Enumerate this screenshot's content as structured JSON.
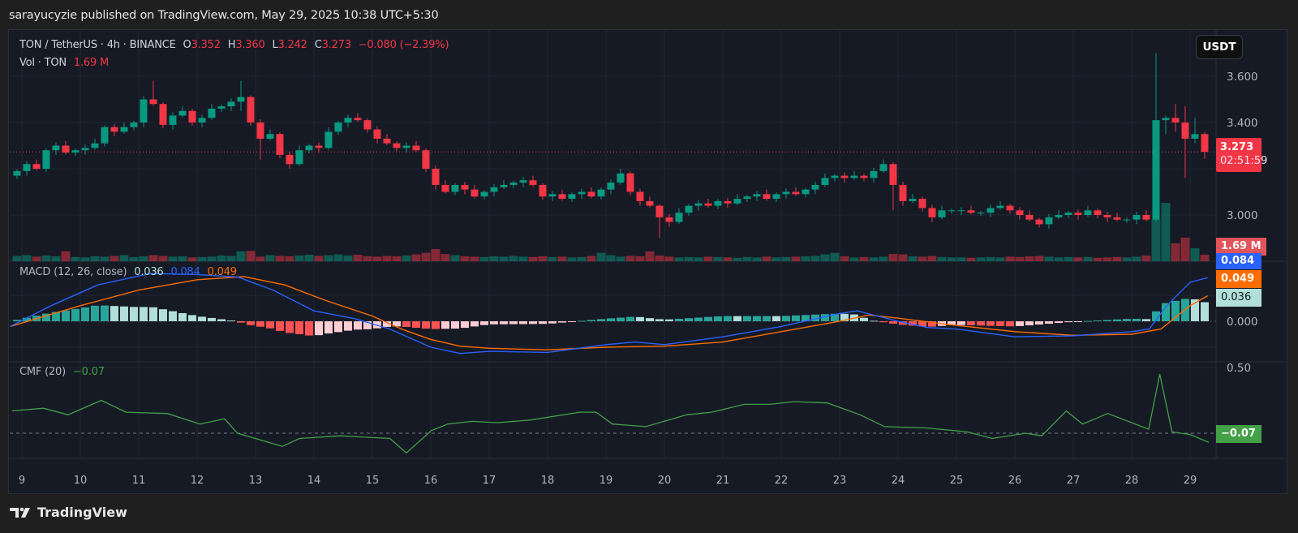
{
  "header": {
    "published": "sarayucyzie published on TradingView.com, May 29, 2025 10:38 UTC+5:30"
  },
  "legend": {
    "symbol": "TON / TetherUS · 4h · BINANCE",
    "o_label": "O",
    "o": "3.352",
    "h_label": "H",
    "h": "3.360",
    "l_label": "L",
    "l": "3.242",
    "c_label": "C",
    "c": "3.273",
    "change": "−0.080 (−2.39%)",
    "vol_label": "Vol · TON",
    "vol": "1.69 M"
  },
  "currency_button": "USDT",
  "price_label": {
    "price": "3.273",
    "countdown": "02:51:59"
  },
  "volume_label": "1.69 M",
  "macd_legend": {
    "title": "MACD (12, 26, close)",
    "hist": "0.036",
    "macd": "0.084",
    "signal": "0.049"
  },
  "cmf_legend": {
    "title": "CMF (20)",
    "value": "−0.07"
  },
  "footer": {
    "brand": "TradingView"
  },
  "colors": {
    "up": "#089981",
    "down": "#f23645",
    "macd": "#2962ff",
    "signal": "#ff6d00",
    "hist_up_strong": "#26a69a",
    "hist_up_weak": "#b2dfdb",
    "hist_down_strong": "#ff5252",
    "hist_down_weak": "#ffcdd2",
    "cmf": "#43a047",
    "background": "#161a25"
  },
  "chart_data": [
    {
      "type": "candlestick",
      "title": "TON / TetherUS · 4h · BINANCE",
      "first_candle_day": 8.833,
      "candles_per_day": 6,
      "x_ticks": [
        "9",
        "10",
        "11",
        "12",
        "13",
        "14",
        "15",
        "16",
        "17",
        "18",
        "19",
        "20",
        "21",
        "22",
        "23",
        "24",
        "25",
        "26",
        "27",
        "28",
        "29"
      ],
      "y_ticks": [
        {
          "value": 3.6,
          "label": "3.600"
        },
        {
          "value": 3.4,
          "label": "3.400"
        },
        {
          "value": 3.0,
          "label": "3.000"
        }
      ],
      "grid_levels": [
        3.0,
        3.2,
        3.4,
        3.6
      ],
      "ylim": [
        2.8,
        3.8
      ],
      "first_open": 3.17,
      "close": [
        3.19,
        3.22,
        3.2,
        3.28,
        3.3,
        3.27,
        3.28,
        3.29,
        3.31,
        3.38,
        3.36,
        3.38,
        3.4,
        3.5,
        3.48,
        3.39,
        3.43,
        3.45,
        3.4,
        3.42,
        3.46,
        3.47,
        3.49,
        3.51,
        3.4,
        3.33,
        3.35,
        3.26,
        3.22,
        3.28,
        3.3,
        3.29,
        3.36,
        3.4,
        3.42,
        3.41,
        3.37,
        3.33,
        3.31,
        3.29,
        3.3,
        3.28,
        3.2,
        3.13,
        3.1,
        3.13,
        3.11,
        3.08,
        3.1,
        3.12,
        3.13,
        3.14,
        3.15,
        3.13,
        3.08,
        3.09,
        3.07,
        3.09,
        3.1,
        3.08,
        3.11,
        3.14,
        3.18,
        3.1,
        3.06,
        3.04,
        2.99,
        2.97,
        3.01,
        3.04,
        3.05,
        3.04,
        3.06,
        3.05,
        3.07,
        3.08,
        3.09,
        3.07,
        3.09,
        3.1,
        3.09,
        3.11,
        3.13,
        3.16,
        3.17,
        3.16,
        3.17,
        3.16,
        3.19,
        3.22,
        3.13,
        3.06,
        3.07,
        3.03,
        2.99,
        3.02,
        3.02,
        3.02,
        3.01,
        3.01,
        3.03,
        3.04,
        3.02,
        3.0,
        2.98,
        2.96,
        2.99,
        3.0,
        3.01,
        3.0,
        3.02,
        3.0,
        2.99,
        2.98,
        2.98,
        3.0,
        2.98,
        3.41,
        3.42,
        3.4,
        3.33,
        3.35,
        3.273
      ],
      "wick_overrides": [
        {
          "i": 14,
          "high": 3.58
        },
        {
          "i": 23,
          "high": 3.58,
          "low": 3.45
        },
        {
          "i": 25,
          "low": 3.24
        },
        {
          "i": 66,
          "low": 2.9
        },
        {
          "i": 90,
          "low": 3.02
        },
        {
          "i": 117,
          "high": 3.7,
          "low": 2.97
        },
        {
          "i": 118,
          "high": 3.43,
          "low": 3.35
        },
        {
          "i": 119,
          "high": 3.48,
          "low": 3.36
        },
        {
          "i": 120,
          "high": 3.47,
          "low": 3.16
        },
        {
          "i": 121,
          "high": 3.42
        },
        {
          "i": 122,
          "high": 3.36,
          "low": 3.242
        }
      ],
      "current_price": 3.273,
      "volume_millions": [
        1.4,
        1.6,
        1.2,
        1.5,
        1.3,
        2.6,
        1.1,
        1.0,
        1.3,
        1.2,
        1.4,
        1.6,
        1.1,
        1.3,
        1.6,
        1.4,
        1.2,
        1.3,
        1.0,
        1.1,
        1.2,
        1.5,
        1.4,
        2.6,
        2.7,
        1.2,
        1.6,
        1.4,
        1.3,
        1.5,
        1.7,
        1.4,
        1.6,
        1.8,
        1.5,
        1.7,
        1.3,
        1.2,
        1.4,
        1.3,
        1.5,
        1.8,
        2.2,
        3.2,
        1.9,
        1.6,
        1.3,
        1.2,
        1.1,
        1.3,
        1.2,
        1.4,
        1.2,
        1.1,
        1.3,
        1.1,
        1.2,
        1.0,
        1.1,
        1.4,
        2.2,
        1.6,
        1.2,
        1.4,
        1.3,
        2.6,
        1.5,
        1.2,
        1.0,
        1.1,
        1.0,
        1.2,
        1.1,
        1.0,
        0.9,
        1.1,
        1.0,
        1.2,
        1.0,
        1.1,
        1.2,
        1.3,
        1.4,
        1.8,
        2.2,
        1.3,
        1.0,
        1.1,
        1.0,
        1.2,
        1.9,
        1.8,
        1.3,
        1.2,
        1.4,
        1.1,
        1.0,
        1.0,
        0.9,
        1.0,
        1.1,
        1.0,
        1.2,
        1.1,
        1.3,
        1.4,
        1.2,
        1.0,
        1.1,
        1.0,
        1.1,
        0.9,
        1.0,
        1.1,
        1.0,
        1.2,
        1.5,
        11.0,
        15.3,
        4.7,
        6.2,
        3.4,
        1.69
      ]
    },
    {
      "type": "line",
      "title": "MACD (12, 26, close)",
      "y_ticks": [
        {
          "value": 0,
          "label": "0.000"
        }
      ],
      "ylim": [
        -0.078,
        0.116
      ],
      "x_unit": "day of May 2025",
      "macd": [
        [
          8.8,
          -0.01
        ],
        [
          9.5,
          0.03
        ],
        [
          10.3,
          0.07
        ],
        [
          11.2,
          0.092
        ],
        [
          12,
          0.09
        ],
        [
          12.7,
          0.085
        ],
        [
          13.3,
          0.06
        ],
        [
          14,
          0.02
        ],
        [
          14.7,
          0.005
        ],
        [
          15.3,
          -0.015
        ],
        [
          16,
          -0.05
        ],
        [
          16.5,
          -0.062
        ],
        [
          17,
          -0.058
        ],
        [
          18,
          -0.06
        ],
        [
          19,
          -0.045
        ],
        [
          19.5,
          -0.04
        ],
        [
          20,
          -0.045
        ],
        [
          21,
          -0.03
        ],
        [
          22,
          -0.01
        ],
        [
          23,
          0.015
        ],
        [
          23.3,
          0.02
        ],
        [
          24,
          0.0
        ],
        [
          24.5,
          -0.012
        ],
        [
          25,
          -0.015
        ],
        [
          26,
          -0.03
        ],
        [
          27,
          -0.028
        ],
        [
          28,
          -0.02
        ],
        [
          28.3,
          -0.015
        ],
        [
          28.6,
          0.03
        ],
        [
          29,
          0.075
        ],
        [
          29.3,
          0.084
        ]
      ],
      "signal": [
        [
          8.8,
          -0.01
        ],
        [
          10,
          0.03
        ],
        [
          11,
          0.06
        ],
        [
          12,
          0.08
        ],
        [
          12.8,
          0.086
        ],
        [
          13.5,
          0.07
        ],
        [
          14.2,
          0.04
        ],
        [
          15,
          0.01
        ],
        [
          15.5,
          -0.015
        ],
        [
          16,
          -0.035
        ],
        [
          16.5,
          -0.048
        ],
        [
          17,
          -0.052
        ],
        [
          18,
          -0.055
        ],
        [
          19,
          -0.05
        ],
        [
          20,
          -0.048
        ],
        [
          21,
          -0.04
        ],
        [
          22,
          -0.02
        ],
        [
          23,
          0.0
        ],
        [
          23.5,
          0.012
        ],
        [
          24,
          0.006
        ],
        [
          25,
          -0.008
        ],
        [
          26,
          -0.02
        ],
        [
          27,
          -0.027
        ],
        [
          28,
          -0.025
        ],
        [
          28.5,
          -0.015
        ],
        [
          29,
          0.03
        ],
        [
          29.3,
          0.049
        ]
      ],
      "histogram_last": 0.036
    },
    {
      "type": "line",
      "title": "CMF (20)",
      "y_ticks": [
        {
          "value": 0.5,
          "label": "0.50"
        },
        {
          "value": 0,
          "label": "0.00"
        }
      ],
      "ylim": [
        -0.18,
        0.54
      ],
      "cmf": [
        [
          8.83,
          0.17
        ],
        [
          9.37,
          0.19
        ],
        [
          9.79,
          0.14
        ],
        [
          10.36,
          0.25
        ],
        [
          10.78,
          0.16
        ],
        [
          11.49,
          0.15
        ],
        [
          12.05,
          0.07
        ],
        [
          12.47,
          0.11
        ],
        [
          12.69,
          0.0
        ],
        [
          13.46,
          -0.1
        ],
        [
          13.75,
          -0.04
        ],
        [
          14.45,
          -0.02
        ],
        [
          14.88,
          -0.03
        ],
        [
          15.3,
          -0.04
        ],
        [
          15.58,
          -0.15
        ],
        [
          16.01,
          0.02
        ],
        [
          16.29,
          0.07
        ],
        [
          16.71,
          0.09
        ],
        [
          17.14,
          0.08
        ],
        [
          17.7,
          0.1
        ],
        [
          18.55,
          0.16
        ],
        [
          18.83,
          0.16
        ],
        [
          19.11,
          0.07
        ],
        [
          19.68,
          0.05
        ],
        [
          20.38,
          0.14
        ],
        [
          20.81,
          0.16
        ],
        [
          21.37,
          0.22
        ],
        [
          21.8,
          0.22
        ],
        [
          22.22,
          0.24
        ],
        [
          22.79,
          0.23
        ],
        [
          23.35,
          0.14
        ],
        [
          23.77,
          0.05
        ],
        [
          24.48,
          0.04
        ],
        [
          25.19,
          0.01
        ],
        [
          25.61,
          -0.04
        ],
        [
          26.18,
          0.0
        ],
        [
          26.46,
          -0.02
        ],
        [
          26.88,
          0.17
        ],
        [
          27.16,
          0.07
        ],
        [
          27.59,
          0.15
        ],
        [
          28.29,
          0.03
        ],
        [
          28.48,
          0.45
        ],
        [
          28.69,
          0.01
        ],
        [
          29.0,
          -0.01
        ],
        [
          29.32,
          -0.07
        ]
      ]
    }
  ]
}
